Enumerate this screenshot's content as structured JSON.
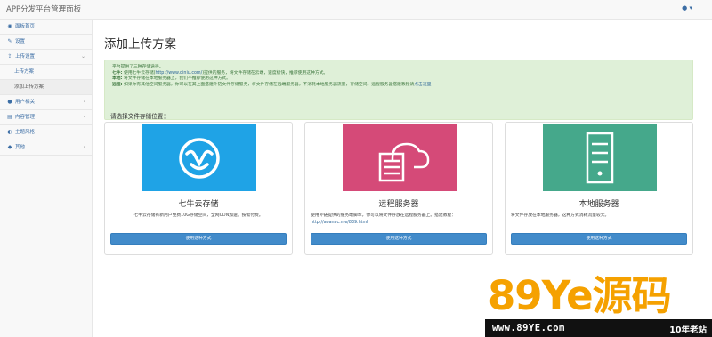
{
  "app": {
    "title": "APP分发平台管理面板"
  },
  "header": {
    "user_caret": "▾"
  },
  "sidebar": {
    "items": [
      {
        "label": "面板首页",
        "icon": "dashboard-icon",
        "glyph": "◉"
      },
      {
        "label": "设置",
        "icon": "wrench-icon",
        "glyph": "✎"
      },
      {
        "label": "上传设置",
        "icon": "upload-icon",
        "glyph": "⇪",
        "chevron": "⌄"
      },
      {
        "label": "上传方案",
        "sub": true
      },
      {
        "label": "添加上传方案",
        "sub": true,
        "active": true
      },
      {
        "label": "用户相关",
        "icon": "user-icon",
        "glyph": "●",
        "chevron": "‹"
      },
      {
        "label": "内容管理",
        "icon": "content-icon",
        "glyph": "▤",
        "chevron": "‹"
      },
      {
        "label": "主题风格",
        "icon": "theme-icon",
        "glyph": "◐"
      },
      {
        "label": "其他",
        "icon": "other-icon",
        "glyph": "◆",
        "chevron": "‹"
      }
    ]
  },
  "main": {
    "title": "添加上传方案",
    "alert": {
      "line1": "平台提供了三种存储途径。",
      "line2_label": "七牛:",
      "line2_pre": " 使用七牛云存储(",
      "line2_link": "http://www.qiniu.com/",
      "line2_post": ")提供的服务，将文件存储在云端，速度极快，推荐使用这种方式。",
      "line3_label": "本地:",
      "line3_text": " 将文件存储在本地服务器上，我们不推荐使用这种方式。",
      "line4_label": "远程:",
      "line4_text": " 如果你有其他空间服务器，你可以在其上面搭建外链文件存储服务，将文件存储在远端服务器，不消耗本地服务器流量，存储空间。远程服务器搭建教程请",
      "line4_link": "点击这里"
    },
    "choose_label": "请选择文件存储位置：",
    "cards": [
      {
        "title": "七牛云存储",
        "desc": "七牛云存储有新用户免费10G存储空间，全网CDN加速，按需付费。",
        "button": "使用这种方式",
        "color": "#1fa3e6"
      },
      {
        "title": "远程服务器",
        "desc": "使用外链提供的服务端脚本，你可以将文件存放在远程服务器上。搭建教程：",
        "link": "http://aoanac.me/839.html",
        "button": "使用这种方式",
        "color": "#d54a78"
      },
      {
        "title": "本地服务器",
        "desc": "将文件存放在本地服务器，这种方式消耗流量较大。",
        "button": "使用这种方式",
        "color": "#45a88b"
      }
    ]
  },
  "watermark": {
    "big": "89Ye源码",
    "url": "www.89YE.com",
    "tag": "10年老站"
  }
}
